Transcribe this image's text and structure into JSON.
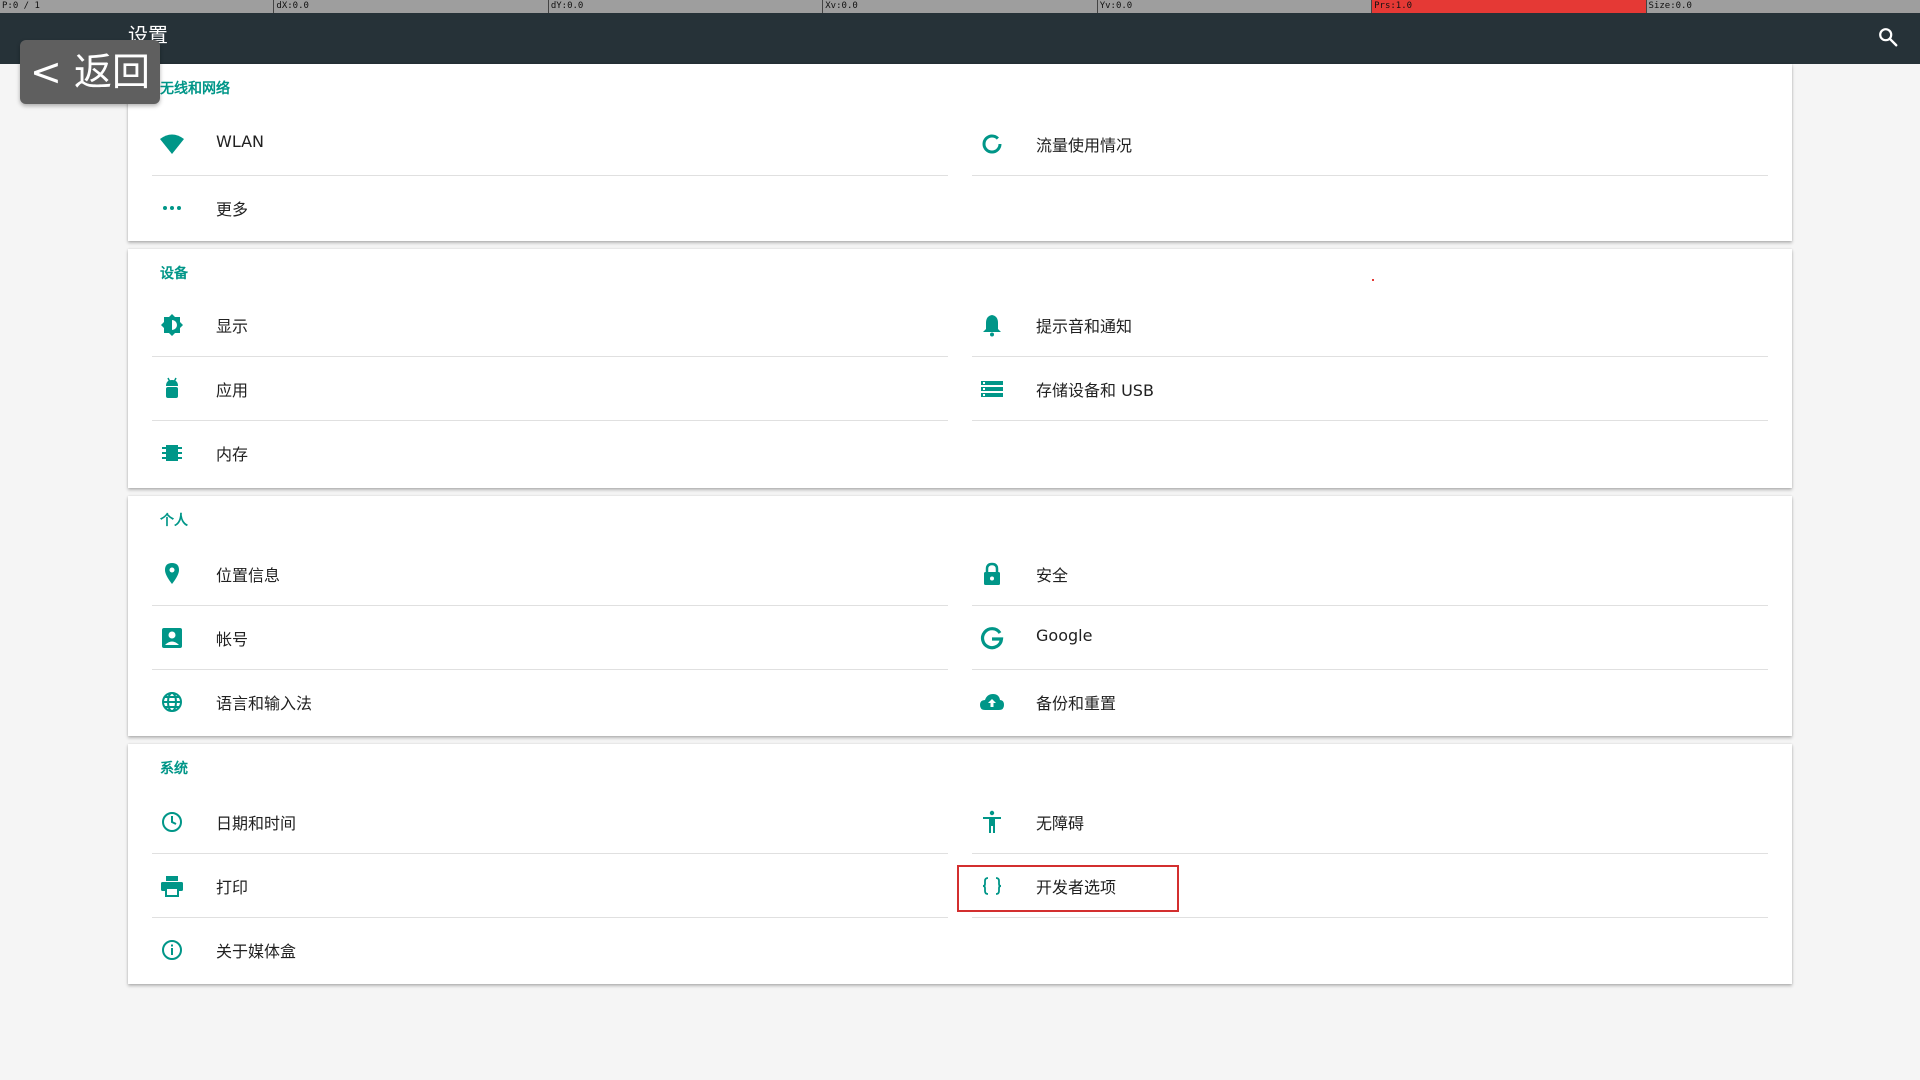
{
  "debug": {
    "pointer": "P:0 / 1",
    "dx": "dX:0.0",
    "dy": "dY:0.0",
    "xv": "Xv:0.0",
    "yv": "Yv:0.0",
    "prs": "Prs:1.0",
    "size": "Size:0.0",
    "alert_color": "#e53935"
  },
  "appbar": {
    "title": "设置",
    "search_icon": "search-icon",
    "background": "#263238"
  },
  "back_button": {
    "label": "< 返回"
  },
  "accent_color": "#009688",
  "sections": [
    {
      "header": "无线和网络",
      "items": [
        {
          "label": "WLAN",
          "icon": "wifi-icon"
        },
        {
          "label": "流量使用情况",
          "icon": "data-usage-icon"
        },
        {
          "label": "更多",
          "icon": "more-dots-icon"
        }
      ]
    },
    {
      "header": "设备",
      "items": [
        {
          "label": "显示",
          "icon": "brightness-icon"
        },
        {
          "label": "提示音和通知",
          "icon": "bell-icon"
        },
        {
          "label": "应用",
          "icon": "android-icon"
        },
        {
          "label": "存储设备和 USB",
          "icon": "storage-icon"
        },
        {
          "label": "内存",
          "icon": "memory-chip-icon"
        }
      ]
    },
    {
      "header": "个人",
      "items": [
        {
          "label": "位置信息",
          "icon": "location-pin-icon"
        },
        {
          "label": "安全",
          "icon": "lock-icon"
        },
        {
          "label": "帐号",
          "icon": "account-box-icon"
        },
        {
          "label": "Google",
          "icon": "google-g-icon"
        },
        {
          "label": "语言和输入法",
          "icon": "globe-icon"
        },
        {
          "label": "备份和重置",
          "icon": "cloud-upload-icon"
        }
      ]
    },
    {
      "header": "系统",
      "items": [
        {
          "label": "日期和时间",
          "icon": "clock-icon"
        },
        {
          "label": "无障碍",
          "icon": "accessibility-icon"
        },
        {
          "label": "打印",
          "icon": "printer-icon"
        },
        {
          "label": "开发者选项",
          "icon": "code-braces-icon",
          "highlighted": true
        },
        {
          "label": "关于媒体盒",
          "icon": "info-icon"
        }
      ]
    }
  ]
}
